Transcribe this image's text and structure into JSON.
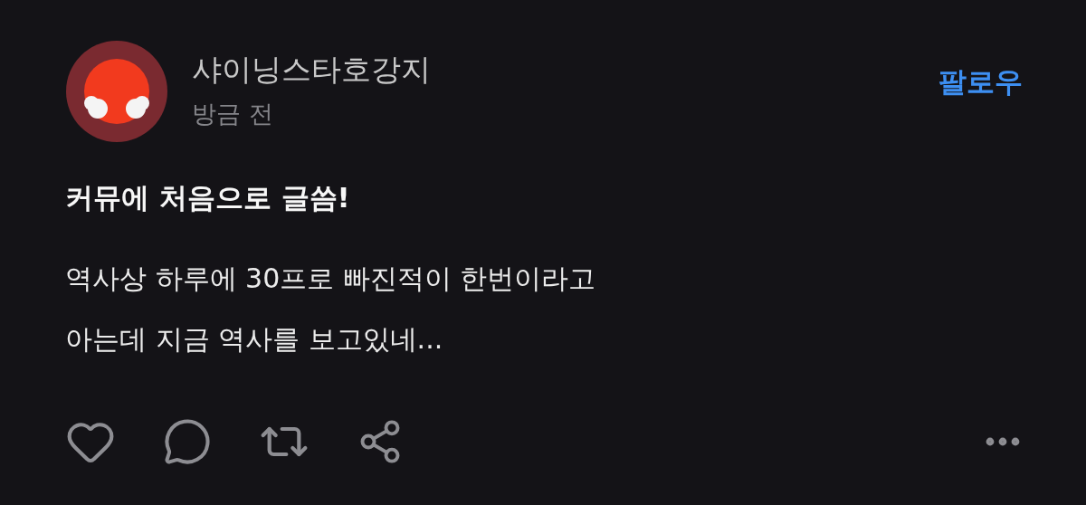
{
  "post": {
    "author": "샤이닝스타호강지",
    "time": "방금 전",
    "follow_label": "팔로우",
    "title": "커뮤에 처음으로 글씀!",
    "body_lines": [
      "역사상 하루에 30프로 빠진적이 한번이라고",
      "아는데 지금 역사를 보고있네..."
    ]
  }
}
